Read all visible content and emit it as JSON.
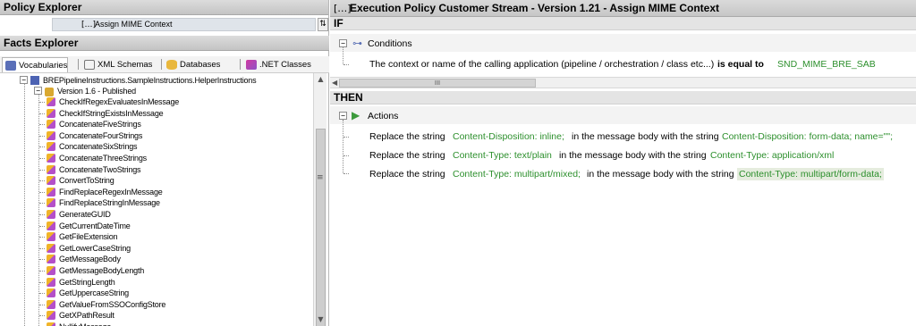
{
  "policy_explorer": {
    "title": "Policy Explorer",
    "selected_rule": "Assign MIME Context"
  },
  "facts_explorer": {
    "title": "Facts Explorer",
    "tabs": [
      {
        "label": "Vocabularies",
        "icon": "vocabulary-icon"
      },
      {
        "label": "XML Schemas",
        "icon": "xml-schema-icon"
      },
      {
        "label": "Databases",
        "icon": "database-icon"
      },
      {
        "label": ".NET Classes",
        "icon": "dotnet-class-icon"
      }
    ],
    "tree": {
      "vocabulary": "BREPipelineInstructions.SampleInstructions.HelperInstructions",
      "version": "Version 1.6 - Published",
      "items": [
        "CheckIfRegexEvaluatesInMessage",
        "CheckIfStringExistsInMessage",
        "ConcatenateFiveStrings",
        "ConcatenateFourStrings",
        "ConcatenateSixStrings",
        "ConcatenateThreeStrings",
        "ConcatenateTwoStrings",
        "ConvertToString",
        "FindReplaceRegexInMessage",
        "FindReplaceStringInMessage",
        "GenerateGUID",
        "GetCurrentDateTime",
        "GetFileExtension",
        "GetLowerCaseString",
        "GetMessageBody",
        "GetMessageBodyLength",
        "GetStringLength",
        "GetUppercaseString",
        "GetValueFromSSOConfigStore",
        "GetXPathResult",
        "NullifyMessage"
      ]
    }
  },
  "rule_editor": {
    "title": "Execution Policy Customer Stream - Version 1.21 - Assign MIME Context",
    "if_label": "IF",
    "conditions_label": "Conditions",
    "condition": {
      "subject": "The context or name of the calling application (pipeline / orchestration / class etc...)",
      "operator": "is equal to",
      "value": "SND_MIME_BRE_SAB"
    },
    "then_label": "THEN",
    "actions_label": "Actions",
    "actions": [
      {
        "prefix": "Replace the string",
        "find": "Content-Disposition: inline;",
        "middle": "in the message body with the string",
        "replace": "Content-Disposition: form-data; name=\"\";"
      },
      {
        "prefix": "Replace the string",
        "find": "Content-Type: text/plain",
        "middle": "in the message body with the string",
        "replace": "Content-Type: application/xml"
      },
      {
        "prefix": "Replace the string",
        "find": "Content-Type: multipart/mixed;",
        "middle": "in the message body with the string",
        "replace": "Content-Type: multipart/form-data;"
      }
    ],
    "scroll_grip": "III"
  },
  "colors": {
    "header_bg": "#c8c8c8",
    "value_green": "#2c8f2c",
    "selection_bg": "#dfe4ea"
  }
}
